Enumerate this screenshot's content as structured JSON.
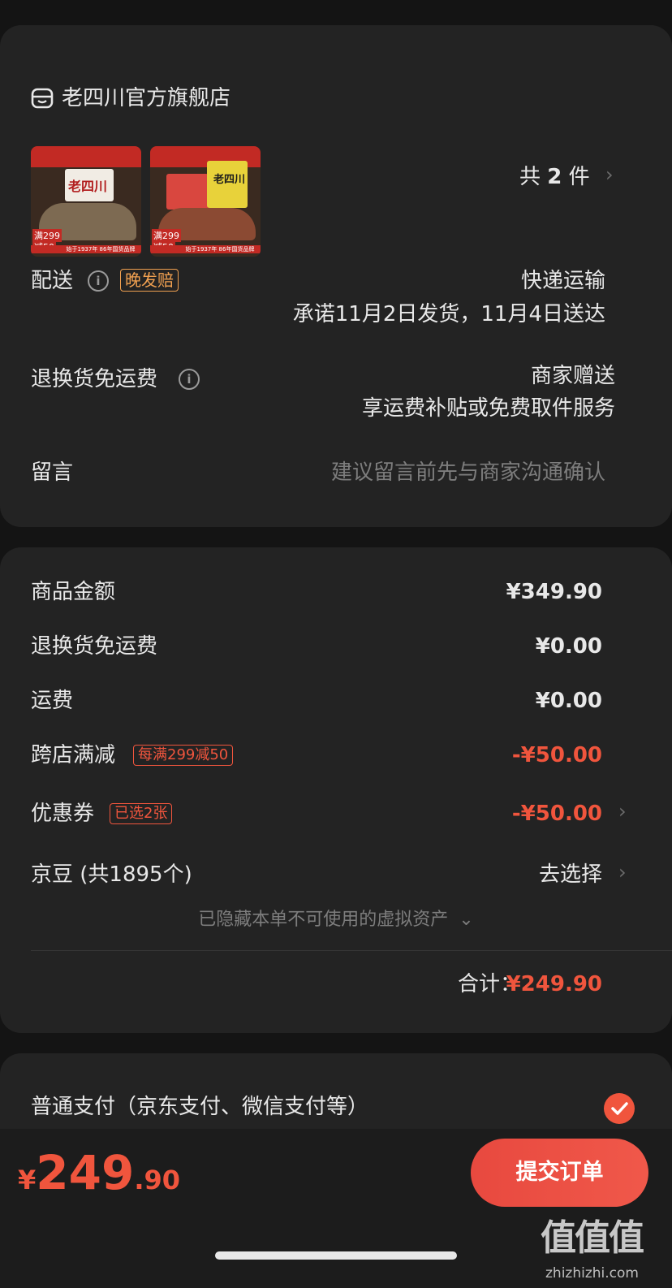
{
  "shop": {
    "name": "老四川官方旗舰店"
  },
  "items": {
    "count_prefix": "共",
    "count": "2",
    "count_suffix": "件",
    "product1": {
      "logo_text": "老四川",
      "promo1": "满299",
      "promo2": "减50",
      "footer": "始于1937年 86年国货品牌"
    },
    "product2": {
      "logo_text": "老四川",
      "promo1": "满299",
      "promo2": "减50",
      "footer": "始于1937年 86年国货品牌"
    }
  },
  "delivery": {
    "label": "配送",
    "badge": "晚发赔",
    "method": "快递运输",
    "promise": "承诺11月2日发货，11月4日送达"
  },
  "return_shipping": {
    "label": "退换货免运费",
    "value": "商家赠送",
    "detail": "享运费补贴或免费取件服务"
  },
  "message": {
    "label": "留言",
    "placeholder": "建议留言前先与商家沟通确认"
  },
  "summary": {
    "goods_label": "商品金额",
    "goods_value": "¥349.90",
    "return_label": "退换货免运费",
    "return_value": "¥0.00",
    "freight_label": "运费",
    "freight_value": "¥0.00",
    "cross_label": "跨店满减",
    "cross_tag": "每满299减50",
    "cross_value": "-¥50.00",
    "coupon_label": "优惠券",
    "coupon_tag": "已选2张",
    "coupon_value": "-¥50.00",
    "beans_label": "京豆 (共1895个)",
    "beans_value": "去选择",
    "hidden_note": "已隐藏本单不可使用的虚拟资产",
    "total_label": "合计：",
    "total_value": "¥249.90"
  },
  "payment": {
    "label": "普通支付（京东支付、微信支付等）"
  },
  "bottom_bar": {
    "currency": "¥",
    "amount_int": "249",
    "amount_dec": ".90",
    "submit": "提交订单"
  },
  "watermark": {
    "site": "zhizhizhi.com"
  },
  "colors": {
    "accent": "#f0553d",
    "badge_orange": "#f0a050",
    "background": "#141414",
    "card": "#232323"
  }
}
